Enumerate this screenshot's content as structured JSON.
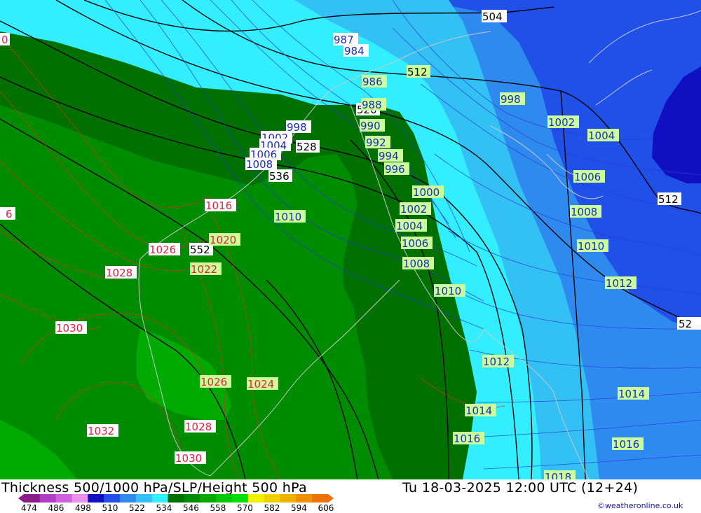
{
  "title": "Thickness 500/1000 hPa/SLP/Height 500 hPa",
  "datetime": "Tu 18-03-2025 12:00 UTC (12+24)",
  "credit": "©weatheronline.co.uk",
  "legend": {
    "values": [
      "474",
      "486",
      "498",
      "510",
      "522",
      "534",
      "546",
      "558",
      "570",
      "582",
      "594",
      "606"
    ],
    "colors": [
      "#8b1a8b",
      "#b03cc8",
      "#d060e0",
      "#e890f0",
      "#1010c0",
      "#2050e8",
      "#2f8af0",
      "#33c0f5",
      "#33eeff",
      "#007000",
      "#008c00",
      "#00aa00",
      "#00c800",
      "#00e000",
      "#f0f000",
      "#f0d000",
      "#f0b000",
      "#f09000",
      "#f07000"
    ]
  },
  "map_labels": {
    "height": [
      "504",
      "512",
      "512",
      "520",
      "528",
      "536",
      "552",
      "52"
    ],
    "slp_blue": [
      "987",
      "984",
      "986",
      "988",
      "990",
      "992",
      "994",
      "996",
      "998",
      "1000",
      "1002",
      "1004",
      "1006",
      "1008",
      "1010",
      "1002",
      "1004",
      "1006",
      "1008",
      "1010",
      "1012",
      "1004",
      "1006",
      "1008",
      "1008",
      "1010",
      "1012",
      "1012",
      "1014",
      "1014",
      "1016",
      "1016",
      "1018",
      "1002",
      "998",
      "1004",
      "1006",
      "1006",
      "1008"
    ],
    "slp_red": [
      "0",
      "6",
      "1016",
      "1020",
      "1026",
      "1022",
      "1028",
      "1030",
      "1026",
      "1024",
      "1028",
      "1032",
      "1030"
    ]
  },
  "colors": {
    "background": "#ffffff",
    "thickness_522": "#33eeff",
    "thickness_510": "#33c0f5",
    "thickness_498": "#2f8af0",
    "thickness_486": "#2050e8",
    "thickness_474": "#1010c0",
    "thickness_534": "#007000",
    "thickness_546": "#008c00",
    "thickness_558": "#00aa00"
  }
}
